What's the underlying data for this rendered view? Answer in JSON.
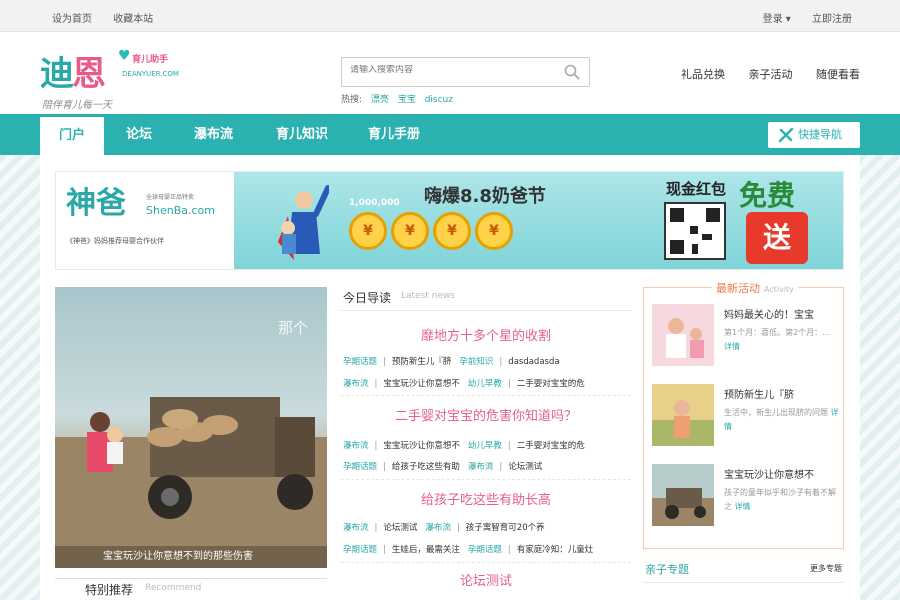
{
  "topbar": {
    "set_home": "设为首页",
    "bookmark": "收藏本站",
    "login": "登录 ▾",
    "register": "立即注册"
  },
  "logo": {
    "name_part1": "迪",
    "name_part2": "恩",
    "tag": "育儿助手",
    "domain": "DEANYUER.COM",
    "slogan": "陪伴育儿每一天"
  },
  "search": {
    "placeholder": "请输入搜索内容",
    "hot_label": "热搜:",
    "hot_terms": [
      "漂亮",
      "宝宝",
      "discuz"
    ]
  },
  "header_links": [
    "礼品兑换",
    "亲子活动",
    "随便看看"
  ],
  "nav": {
    "items": [
      "门户",
      "论坛",
      "瀑布流",
      "育儿知识",
      "育儿手册"
    ],
    "quick": "快捷导航"
  },
  "banner": {
    "brand": "神爸",
    "brand_en": "ShenBa.com",
    "brand_sub": "全球母婴正品特卖",
    "brand_foot": "《神爸》妈妈推荐母婴合作伙伴",
    "title": "嗨爆8.8奶爸节",
    "coins": [
      "¥",
      "¥",
      "¥",
      "¥"
    ],
    "amount": "1,000,000",
    "cash": "现金红包",
    "free": "免费",
    "send": "送"
  },
  "photo": {
    "caption": "宝宝玩沙让你意想不到的那些伤害",
    "overlay": "那个"
  },
  "special": {
    "title": "特别推荐",
    "en": "Recommend"
  },
  "news": {
    "title": "今日导读",
    "title_en": "Latest news",
    "blocks": [
      {
        "head": "靡地方十多个星的收割",
        "rows": [
          [
            "孕期话题",
            "预防新生儿『脐",
            "孕前知识",
            "dasdadasda"
          ],
          [
            "瀑布流",
            "宝宝玩沙让你意想不",
            "幼儿早教",
            "二手婴对宝宝的危"
          ]
        ]
      },
      {
        "head": "二手婴对宝宝的危害你知道吗？",
        "rows": [
          [
            "瀑布流",
            "宝宝玩沙让你意想不",
            "幼儿早教",
            "二手婴对宝宝的危"
          ],
          [
            "孕期话题",
            "给孩子吃这些有助",
            "瀑布流",
            "论坛测试"
          ]
        ]
      },
      {
        "head": "给孩子吃这些有助长高",
        "rows": [
          [
            "瀑布流",
            "论坛测试",
            "瀑布流",
            "孩子寓智育可20个养"
          ],
          [
            "孕期话题",
            "生娃后，最需关注",
            "孕期话题",
            "有家庭冷知：儿童灶"
          ]
        ]
      },
      {
        "head": "论坛测试",
        "rows": []
      }
    ]
  },
  "activity": {
    "title": "最新活动",
    "title_en": "Activity",
    "more": "详情",
    "items": [
      {
        "title": "妈妈最关心的！宝宝",
        "desc": "第1个月：喜低。第2个月：..."
      },
      {
        "title": "预防新生儿『脐",
        "desc": "生活中，新生儿出现脐的问题"
      },
      {
        "title": "宝宝玩沙让你意想不",
        "desc": "孩子的童年似乎和沙子有着不解之"
      }
    ]
  },
  "topic": {
    "title": "亲子专题",
    "more": "更多专题"
  },
  "colors": {
    "accent": "#2ab1b0",
    "pink": "#e8608a",
    "orange": "#e87b4a"
  }
}
